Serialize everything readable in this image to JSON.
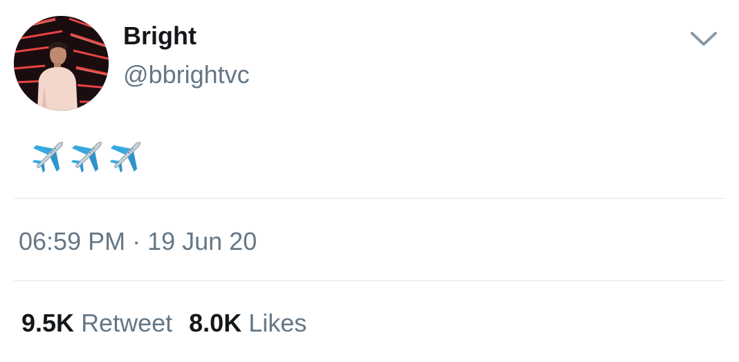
{
  "user": {
    "display_name": "Bright",
    "handle": "@bbrightvc",
    "avatar_icon": "profile-photo"
  },
  "tweet": {
    "emojis": [
      "airplane",
      "airplane",
      "airplane"
    ],
    "timestamp": "06:59 PM · 19 Jun 20"
  },
  "stats": {
    "retweets_count": "9.5K",
    "retweets_label": "Retweet",
    "likes_count": "8.0K",
    "likes_label": "Likes"
  },
  "colors": {
    "text_primary": "#14171a",
    "text_secondary": "#657786",
    "divider": "#e1e8ed",
    "chevron": "#8899a6"
  }
}
